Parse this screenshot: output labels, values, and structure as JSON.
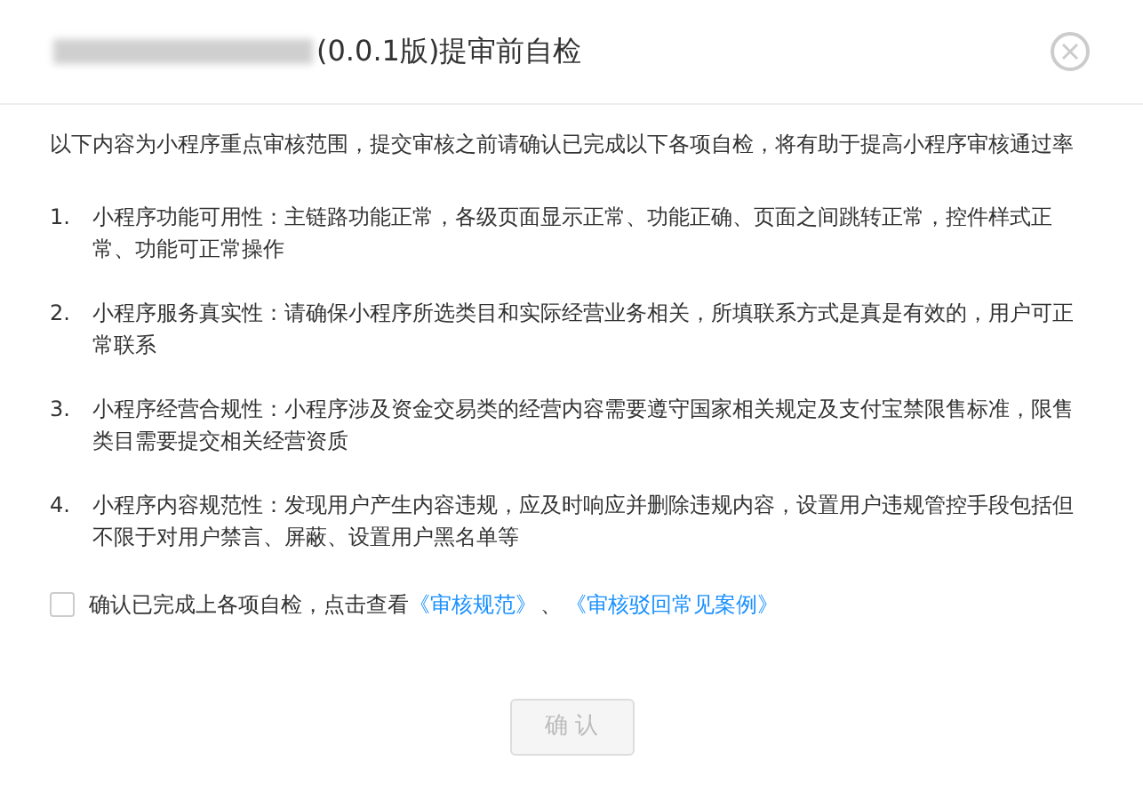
{
  "dialog": {
    "title": "(0.0.1版)提审前自检",
    "title_redacted": true,
    "intro": "以下内容为小程序重点审核范围，提交审核之前请确认已完成以下各项自检，将有助于提高小程序审核通过率",
    "items": [
      {
        "number": "1.",
        "text": "小程序功能可用性：主链路功能正常，各级页面显示正常、功能正确、页面之间跳转正常，控件样式正常、功能可正常操作"
      },
      {
        "number": "2.",
        "text": "小程序服务真实性：请确保小程序所选类目和实际经营业务相关，所填联系方式是真是有效的，用户可正常联系"
      },
      {
        "number": "3.",
        "text": "小程序经营合规性：小程序涉及资金交易类的经营内容需要遵守国家相关规定及支付宝禁限售标准，限售类目需要提交相关经营资质"
      },
      {
        "number": "4.",
        "text": "小程序内容规范性：发现用户产生内容违规，应及时响应并删除违规内容，设置用户违规管控手段包括但不限于对用户禁言、屏蔽、设置用户黑名单等"
      }
    ],
    "confirm_check": {
      "checked": false,
      "label": "确认已完成上各项自检，点击查看",
      "links": [
        "《审核规范》",
        "《审核驳回常见案例》"
      ],
      "separator": "、"
    },
    "confirm_button": {
      "label": "确 认",
      "disabled": true
    }
  }
}
